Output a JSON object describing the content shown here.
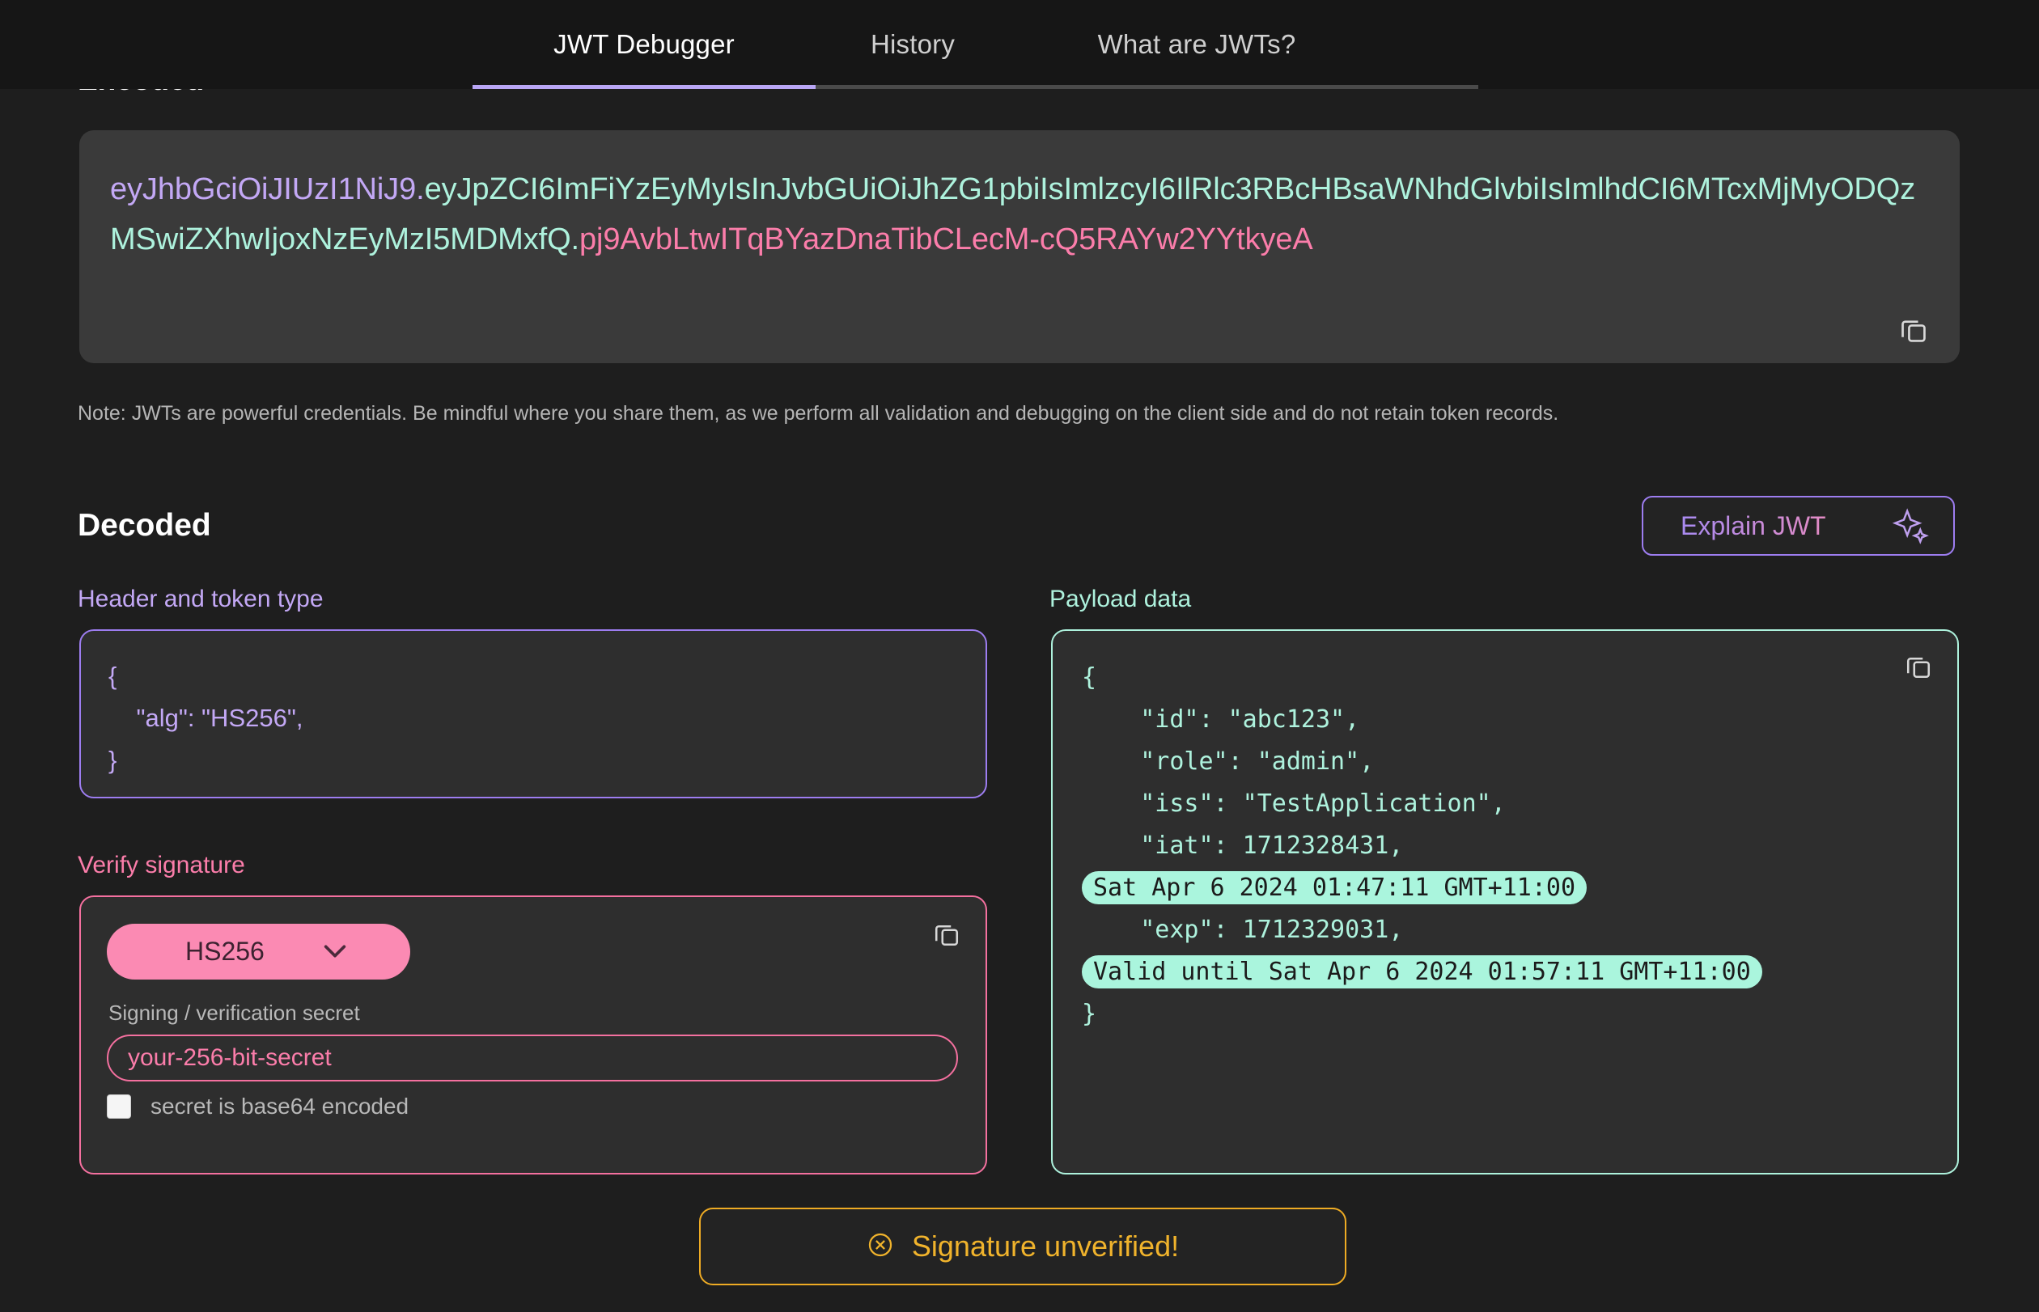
{
  "nav": {
    "tabs": [
      {
        "label": "JWT Debugger",
        "active": true
      },
      {
        "label": "History",
        "active": false
      },
      {
        "label": "What are JWTs?",
        "active": false
      }
    ]
  },
  "encoded": {
    "heading": "Encoded",
    "token": {
      "header": "eyJhbGciOiJIUzI1NiJ9.",
      "payload": "eyJpZCI6ImFiYzEyMyIsInJvbGUiOiJhZG1pbiIsImlzcyI6IlRlc3RBcHBsaWNhdGlvbiIsImlhdCI6MTcxMjMyODQzMSwiZXhwIjoxNzEyMzI5MDMxfQ.",
      "signature": "pj9AvbLtwITqBYazDnaTibCLecM-cQ5RAYw2YYtkyeA"
    },
    "copy_icon": "copy-icon",
    "note": "Note: JWTs are powerful credentials. Be mindful where you share them, as we perform all validation and debugging on the client side and do not retain token records."
  },
  "decoded": {
    "heading": "Decoded",
    "explain_button": {
      "label": "Explain JWT",
      "icon": "sparkle-icon"
    },
    "header_panel": {
      "label": "Header and token type",
      "code": "{\n    \"alg\": \"HS256\",\n}"
    },
    "payload_panel": {
      "label": "Payload data",
      "copy_icon": "copy-icon",
      "lines": [
        {
          "text": "{",
          "pill": false
        },
        {
          "text": "    \"id\": \"abc123\",",
          "pill": false
        },
        {
          "text": "    \"role\": \"admin\",",
          "pill": false
        },
        {
          "text": "    \"iss\": \"TestApplication\",",
          "pill": false
        },
        {
          "text": "    \"iat\": 1712328431,",
          "pill": false
        },
        {
          "text": "Sat Apr 6 2024 01:47:11 GMT+11:00",
          "pill": true
        },
        {
          "text": "    \"exp\": 1712329031,",
          "pill": false
        },
        {
          "text": "Valid until Sat Apr 6 2024 01:57:11 GMT+11:00",
          "pill": true
        },
        {
          "text": "}",
          "pill": false
        }
      ]
    },
    "verify_panel": {
      "label": "Verify signature",
      "algorithm": "HS256",
      "algorithm_chevron_icon": "chevron-down-icon",
      "copy_icon": "copy-icon",
      "secret_label": "Signing / verification secret",
      "secret_value": "your-256-bit-secret",
      "secret_placeholder": "your-256-bit-secret",
      "base64_checkbox_label": "secret is base64 encoded",
      "base64_checked": false
    }
  },
  "status": {
    "icon": "circle-x-icon",
    "text": "Signature unverified!"
  },
  "colors": {
    "accent_purple": "#c3a8f5",
    "accent_mint": "#aef2dd",
    "accent_pink": "#fb7daa",
    "warning": "#f0b32c",
    "background": "#1e1e1e"
  }
}
